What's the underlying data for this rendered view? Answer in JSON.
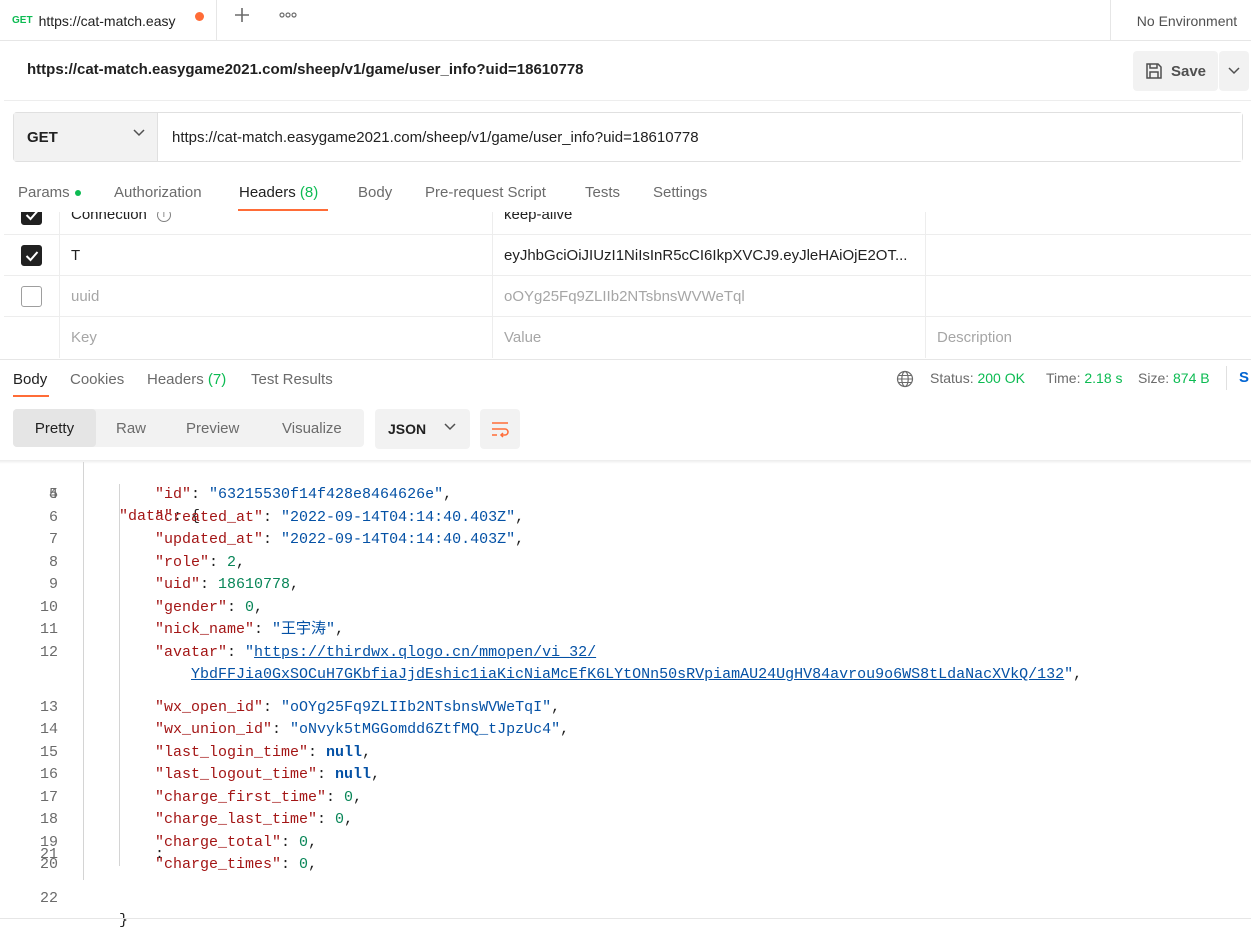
{
  "tabs": {
    "active": {
      "method": "GET",
      "title": "https://cat-match.easy"
    },
    "add_icon": "plus-icon",
    "more_icon": "more-icon"
  },
  "environment": {
    "label": "No Environment"
  },
  "request": {
    "name": "https://cat-match.easygame2021.com/sheep/v1/game/user_info?uid=18610778",
    "save_label": "Save",
    "method": "GET",
    "url": "https://cat-match.easygame2021.com/sheep/v1/game/user_info?uid=18610778"
  },
  "request_tabs": {
    "params": "Params",
    "authorization": "Authorization",
    "headers": "Headers",
    "headers_count": "(8)",
    "body": "Body",
    "prerequest": "Pre-request Script",
    "tests": "Tests",
    "settings": "Settings"
  },
  "headers_table": {
    "rows": [
      {
        "key": "Connection",
        "value": "keep-alive",
        "checked": true
      },
      {
        "key": "T",
        "value": "eyJhbGciOiJIUzI1NiIsInR5cCI6IkpXVCJ9.eyJleHAiOjE2OT...",
        "checked": true
      },
      {
        "key": "uuid",
        "value": "oOYg25Fq9ZLIIb2NTsbnsWVWeTql",
        "checked": false
      }
    ],
    "placeholders": {
      "key": "Key",
      "value": "Value",
      "description": "Description"
    }
  },
  "response_tabs": {
    "body": "Body",
    "cookies": "Cookies",
    "headers": "Headers",
    "headers_count": "(7)",
    "test_results": "Test Results"
  },
  "response_meta": {
    "status_label": "Status:",
    "status_value": "200 OK",
    "time_label": "Time:",
    "time_value": "2.18 s",
    "size_label": "Size:",
    "size_value": "874 B",
    "save_response": "S"
  },
  "response_view": {
    "options": [
      "Pretty",
      "Raw",
      "Preview",
      "Visualize"
    ],
    "active": "Pretty",
    "format": "JSON"
  },
  "code_lines": [
    {
      "n": "4"
    },
    {
      "n": "5",
      "key": "\"id\"",
      "val": "\"63215530f14f428e8464626e\""
    },
    {
      "n": "6",
      "key": "\"created_at\"",
      "val": "\"2022-09-14T04:14:40.403Z\""
    },
    {
      "n": "7",
      "key": "\"updated_at\"",
      "val": "\"2022-09-14T04:14:40.403Z\""
    },
    {
      "n": "8",
      "key": "\"role\"",
      "val": "2"
    },
    {
      "n": "9",
      "key": "\"uid\"",
      "val": "18610778"
    },
    {
      "n": "10",
      "key": "\"gender\"",
      "val": "0"
    },
    {
      "n": "11",
      "key": "\"nick_name\"",
      "val": "\"王宇涛\""
    },
    {
      "n": "12",
      "key": "\"avatar\"",
      "url1": "https://thirdwx.qlogo.cn/mmopen/vi_32/",
      "url2": "YbdFFJia0GxSOCuH7GKbfiaJjdEshic1iaKicNiaMcEfK6LYtONn50sRVpiamAU24UgHV84avrou9o6WS8tLdaNacXVkQ/132"
    },
    {
      "n": "13",
      "key": "\"wx_open_id\"",
      "val": "\"oOYg25Fq9ZLIIb2NTsbnsWVWeTqI\""
    },
    {
      "n": "14",
      "key": "\"wx_union_id\"",
      "val": "\"oNvyk5tMGGomdd6ZtfMQ_tJpzUc4\""
    },
    {
      "n": "15",
      "key": "\"last_login_time\"",
      "val": "null"
    },
    {
      "n": "16",
      "key": "\"last_logout_time\"",
      "val": "null"
    },
    {
      "n": "17",
      "key": "\"charge_first_time\"",
      "val": "0"
    },
    {
      "n": "18",
      "key": "\"charge_last_time\"",
      "val": "0"
    },
    {
      "n": "19",
      "key": "\"charge_total\"",
      "val": "0"
    },
    {
      "n": "20",
      "key": "\"charge_times\"",
      "val": "0"
    },
    {
      "n": "21",
      "text": "}"
    },
    {
      "n": "22",
      "text": "}"
    }
  ],
  "code_tokens": {
    "data_key": "\"data\"",
    "open_brace": "{"
  }
}
